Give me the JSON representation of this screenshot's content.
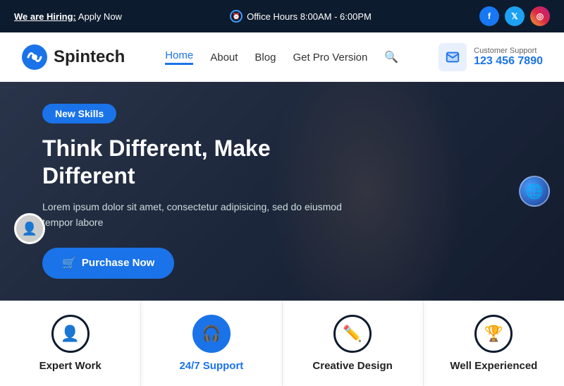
{
  "topbar": {
    "hiring_label": "We are Hiring:",
    "hiring_cta": " Apply Now",
    "office_hours_icon": "🕐",
    "office_hours": "Office Hours 8:00AM - 6:00PM",
    "socials": [
      {
        "name": "facebook",
        "label": "f"
      },
      {
        "name": "twitter",
        "label": "t"
      },
      {
        "name": "instagram",
        "label": "in"
      }
    ]
  },
  "navbar": {
    "logo_text": "Spintech",
    "links": [
      {
        "label": "Home",
        "active": true
      },
      {
        "label": "About",
        "active": false
      },
      {
        "label": "Blog",
        "active": false
      },
      {
        "label": "Get Pro Version",
        "active": false
      }
    ],
    "contact_label": "Customer Support",
    "contact_phone": "123 456 7890"
  },
  "hero": {
    "badge": "New Skills",
    "title": "Think Different, Make Different",
    "description": "Lorem ipsum dolor sit amet, consectetur adipisicing, sed do eiusmod tempor labore",
    "cta_button": "Purchase Now"
  },
  "features": [
    {
      "icon": "👤",
      "label": "Expert Work",
      "highlight": false
    },
    {
      "icon": "🎧",
      "label": "24/7 Support",
      "highlight": true
    },
    {
      "icon": "✏️",
      "label": "Creative Design",
      "highlight": false
    },
    {
      "icon": "🏆",
      "label": "Well Experienced",
      "highlight": false
    }
  ]
}
